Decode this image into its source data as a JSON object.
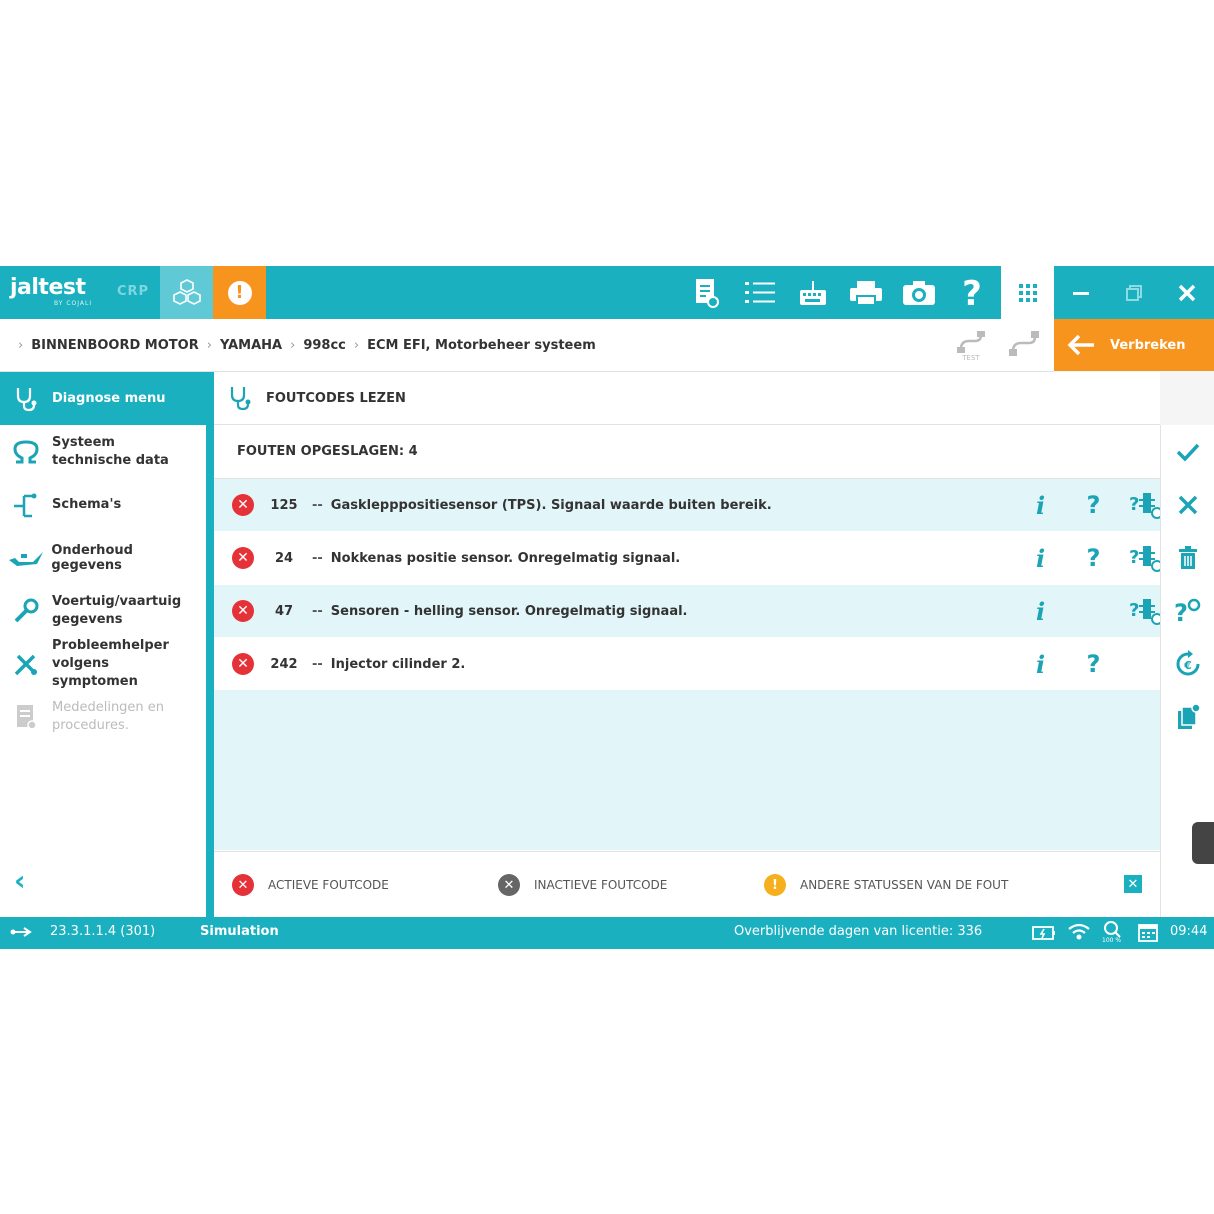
{
  "app": {
    "logo": "jaltest",
    "logo_sub": "BY COJALI",
    "mode": "CRP"
  },
  "window": {
    "minimize": "–",
    "restore": "❐",
    "close": "✕"
  },
  "breadcrumb": [
    "BINNENBOORD MOTOR",
    "YAMAHA",
    "998cc",
    "ECM EFI, Motorbeheer systeem"
  ],
  "disconnect_label": "Verbreken",
  "sidebar": {
    "header": "Diagnose menu",
    "items": [
      {
        "label": "Systeem technische data",
        "icon": "omega-icon",
        "enabled": true
      },
      {
        "label": "Schema's",
        "icon": "wiring-icon",
        "enabled": true
      },
      {
        "label": "Onderhoud gegevens",
        "icon": "oil-can-icon",
        "enabled": true
      },
      {
        "label": "Voertuig/vaartuig gegevens",
        "icon": "wrench-icon",
        "enabled": true
      },
      {
        "label": "Probleemhelper volgens symptomen",
        "icon": "tools-icon",
        "enabled": true
      },
      {
        "label": "Mededelingen en procedures.",
        "icon": "document-icon",
        "enabled": false
      }
    ],
    "back": "‹"
  },
  "main": {
    "title": "FOUTCODES LEZEN",
    "count_label": "FOUTEN OPGESLAGEN: 4",
    "faults": [
      {
        "code": "125",
        "sep": "--",
        "desc": "Gasklepppositiesensor (TPS). Signaal waarde buiten bereik.",
        "info": true,
        "help": true,
        "test": true
      },
      {
        "code": "24",
        "sep": "--",
        "desc": "Nokkenas positie sensor. Onregelmatig signaal.",
        "info": true,
        "help": true,
        "test": true
      },
      {
        "code": "47",
        "sep": "--",
        "desc": "Sensoren - helling sensor. Onregelmatig signaal.",
        "info": true,
        "help": false,
        "test": true
      },
      {
        "code": "242",
        "sep": "--",
        "desc": "Injector cilinder 2.",
        "info": true,
        "help": true,
        "test": false
      }
    ],
    "legend": {
      "active": "ACTIEVE FOUTCODE",
      "inactive": "INACTIEVE FOUTCODE",
      "other": "ANDERE STATUSSEN VAN DE FOUT"
    }
  },
  "status": {
    "version": "23.3.1.1.4 (301)",
    "mode": "Simulation",
    "license": "Overblijvende dagen van licentie: 336",
    "battery_pct": "100 %",
    "time": "09:44"
  },
  "colors": {
    "accent": "#1bb0c0",
    "orange": "#f7941d",
    "error": "#e53238",
    "row_alt": "#e2f5f8"
  }
}
